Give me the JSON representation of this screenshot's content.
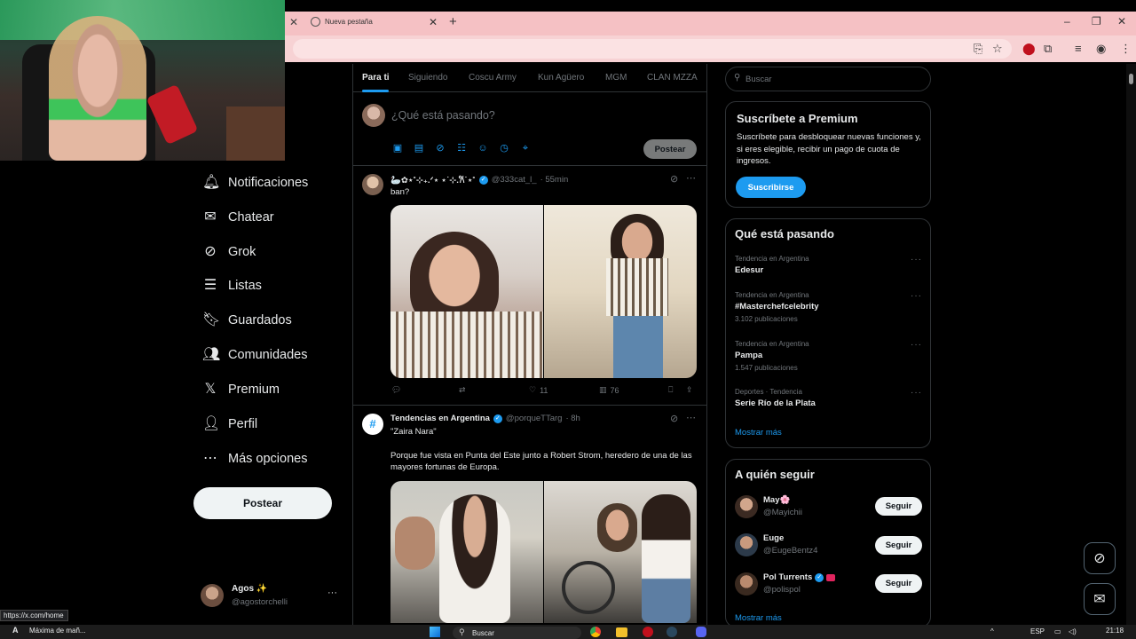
{
  "browser": {
    "tab_title": "Nueva pestaña",
    "status_url": "https://x.com/home"
  },
  "nav": {
    "items": [
      {
        "label": "Notificaciones",
        "icon": "bell-icon"
      },
      {
        "label": "Chatear",
        "icon": "envelope-icon"
      },
      {
        "label": "Grok",
        "icon": "grok-icon"
      },
      {
        "label": "Listas",
        "icon": "list-icon"
      },
      {
        "label": "Guardados",
        "icon": "bookmark-icon"
      },
      {
        "label": "Comunidades",
        "icon": "communities-icon"
      },
      {
        "label": "Premium",
        "icon": "x-logo-icon"
      },
      {
        "label": "Perfil",
        "icon": "person-icon"
      },
      {
        "label": "Más opciones",
        "icon": "more-circle-icon"
      }
    ],
    "post_button": "Postear",
    "account": {
      "name": "Agos ✨",
      "handle": "@agostorchelli",
      "more": "···"
    }
  },
  "feed": {
    "tabs": [
      "Para ti",
      "Siguiendo",
      "Coscu Army",
      "Kun Agüero",
      "MGM",
      "CLAN MZZA"
    ],
    "compose_placeholder": "¿Qué está pasando?",
    "compose_post_button": "Postear",
    "posts": [
      {
        "name": "🦢✿⋆˚⊹₊.ᐟ⋆ ⋆˙⊹.𐙚˙⋆˚",
        "handle": "@333cat_l_",
        "time": "· 55min",
        "text": "ban?",
        "likes": "11",
        "views": "76"
      },
      {
        "name": "Tendencias en Argentina",
        "handle": "@porqueTTarg",
        "time": "· 8h",
        "text_quote": "\"Zaira Nara\"",
        "text": "Porque fue vista en Punta del Este junto a Robert Strom, heredero de una de las mayores fortunas de Europa."
      }
    ]
  },
  "sidebar": {
    "search_placeholder": "Buscar",
    "premium": {
      "title": "Suscríbete a Premium",
      "body": "Suscríbete para desbloquear nuevas funciones y, si eres elegible, recibir un pago de cuota de ingresos.",
      "button": "Suscribirse"
    },
    "trends": {
      "title": "Qué está pasando",
      "items": [
        {
          "context": "Tendencia en Argentina",
          "name": "Edesur",
          "count": ""
        },
        {
          "context": "Tendencia en Argentina",
          "name": "#Masterchefcelebrity",
          "count": "3.102 publicaciones"
        },
        {
          "context": "Tendencia en Argentina",
          "name": "Pampa",
          "count": "1.547 publicaciones"
        },
        {
          "context": "Deportes · Tendencia",
          "name": "Serie Río de la Plata",
          "count": ""
        }
      ],
      "show_more": "Mostrar más"
    },
    "who_to_follow": {
      "title": "A quién seguir",
      "items": [
        {
          "name": "May🌸",
          "handle": "@Mayichii",
          "button": "Seguir"
        },
        {
          "name": "Euge",
          "handle": "@EugeBentz4",
          "button": "Seguir"
        },
        {
          "name": "Pol Turrents",
          "handle": "@polispol",
          "button": "Seguir"
        }
      ],
      "show_more": "Mostrar más"
    }
  },
  "taskbar": {
    "notification": "Máxima de mañ...",
    "search": "Buscar",
    "lang": "ESP",
    "time": "21:18"
  },
  "colors": {
    "accent": "#1d9bf0",
    "tab_bar": "#f5c1c4",
    "background": "#000000"
  }
}
